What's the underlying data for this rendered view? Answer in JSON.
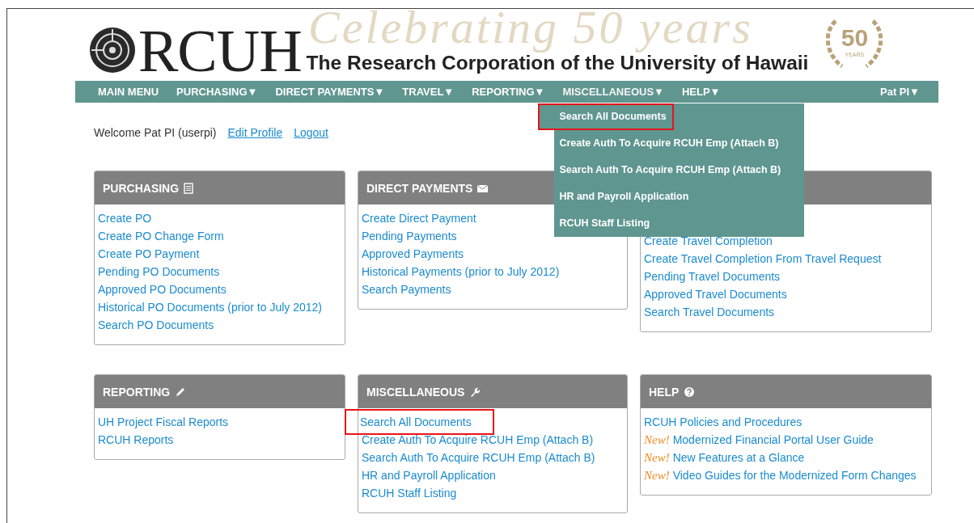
{
  "header": {
    "logo_text": "RCUH",
    "org_name": "The Research Corporation of the University of Hawaii",
    "banner": "Celebrating 50 years",
    "badge_number": "50",
    "badge_text": "YEARS"
  },
  "nav": {
    "items": [
      {
        "label": "MAIN MENU"
      },
      {
        "label": "PURCHASING▼"
      },
      {
        "label": "DIRECT PAYMENTS▼"
      },
      {
        "label": "TRAVEL▼"
      },
      {
        "label": "REPORTING▼"
      },
      {
        "label": "MISCELLANEOUS▼",
        "menu": [
          {
            "label": "Search All Documents",
            "highlighted": true
          },
          {
            "label": "Create Auth To Acquire RCUH Emp (Attach B)",
            "highlighted": false
          },
          {
            "label": "Search Auth To Acquire RCUH Emp (Attach B)",
            "highlighted": false
          },
          {
            "label": "HR and Payroll Application",
            "highlighted": false
          },
          {
            "label": "RCUH Staff Listing",
            "highlighted": false
          }
        ]
      },
      {
        "label": "HELP▼"
      }
    ],
    "user": "Pat PI▼"
  },
  "welcome": {
    "text": "Welcome Pat PI (userpi)",
    "links": [
      "Edit Profile",
      "Logout"
    ]
  },
  "panels": [
    {
      "title": "PURCHASING",
      "links": [
        {
          "label": "Create PO"
        },
        {
          "label": "Create PO Change Form"
        },
        {
          "label": "Create PO Payment"
        },
        {
          "label": "Pending PO Documents"
        },
        {
          "label": "Approved PO Documents"
        },
        {
          "label": "Historical PO Documents (prior to July 2012)"
        },
        {
          "label": "Search PO Documents"
        }
      ]
    },
    {
      "title": "DIRECT PAYMENTS",
      "links": [
        {
          "label": "Create Direct Payment"
        },
        {
          "label": "Pending Payments"
        },
        {
          "label": "Approved Payments"
        },
        {
          "label": "Historical Payments (prior to July 2012)"
        },
        {
          "label": "Search Payments"
        }
      ]
    },
    {
      "links": [
        {
          "label": "Create Travel Completion"
        },
        {
          "label": "Create Travel Completion From Travel Request"
        },
        {
          "label": "Pending Travel Documents"
        },
        {
          "label": "Approved Travel Documents"
        },
        {
          "label": "Search Travel Documents"
        }
      ]
    },
    {
      "title": "REPORTING",
      "links": [
        {
          "label": "UH Project Fiscal Reports"
        },
        {
          "label": "RCUH Reports"
        }
      ]
    },
    {
      "title": "MISCELLANEOUS",
      "links": [
        {
          "label": "Search All Documents",
          "highlighted": true
        },
        {
          "label": "Create Auth To Acquire RCUH Emp (Attach B)"
        },
        {
          "label": "Search Auth To Acquire RCUH Emp (Attach B)"
        },
        {
          "label": "HR and Payroll Application"
        },
        {
          "label": "RCUH Staff Listing"
        }
      ]
    },
    {
      "title": "HELP",
      "links": [
        {
          "label": "RCUH Policies and Procedures"
        },
        {
          "badge": "New!",
          "label": "Modernized Financial Portal User Guide"
        },
        {
          "badge": "New!",
          "label": "New Features at a Glance"
        },
        {
          "badge": "New!",
          "label": "Video Guides for the Modernized Form Changes"
        }
      ]
    }
  ]
}
